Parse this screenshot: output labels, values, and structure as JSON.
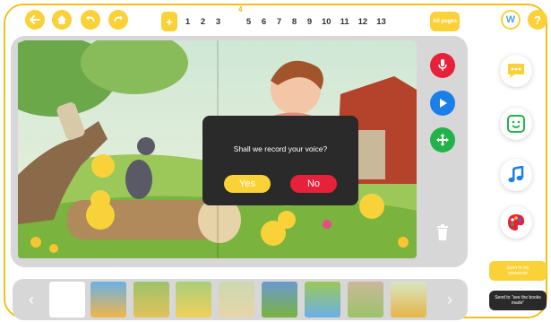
{
  "toolbar": {
    "back_icon": "arrow-left-icon",
    "home_icon": "home-icon",
    "undo_icon": "undo-icon",
    "redo_icon": "redo-icon"
  },
  "pages": {
    "add_label": "+",
    "current_indicator": "4",
    "numbers": [
      "1",
      "2",
      "3",
      "5",
      "6",
      "7",
      "8",
      "9",
      "10",
      "11",
      "12",
      "13"
    ],
    "all_pages_label": "All pages"
  },
  "top_right": {
    "logo_letter": "W",
    "help_label": "?"
  },
  "side_controls": {
    "record_icon": "microphone-icon",
    "play_icon": "play-icon",
    "move_icon": "move-icon",
    "delete_icon": "trash-icon"
  },
  "dialog": {
    "question": "Shall we record your voice?",
    "yes_label": "Yes",
    "no_label": "No"
  },
  "right_tools": {
    "speech_icon": "speech-bubble-icon",
    "sticker_icon": "smiley-sticker-icon",
    "music_icon": "music-note-icon",
    "paint_icon": "paint-palette-icon"
  },
  "send_buttons": {
    "workroom_label": "Send to my workroom",
    "books_made_label": "Send to \"see the books made\""
  },
  "strip": {
    "prev_label": "‹",
    "next_label": "›"
  },
  "colors": {
    "accent_yellow": "#fbd138",
    "record_red": "#e8213a",
    "play_blue": "#1a7fe8",
    "move_green": "#21b34a",
    "dialog_bg": "#2a2a2a",
    "no_red": "#e8213a"
  }
}
